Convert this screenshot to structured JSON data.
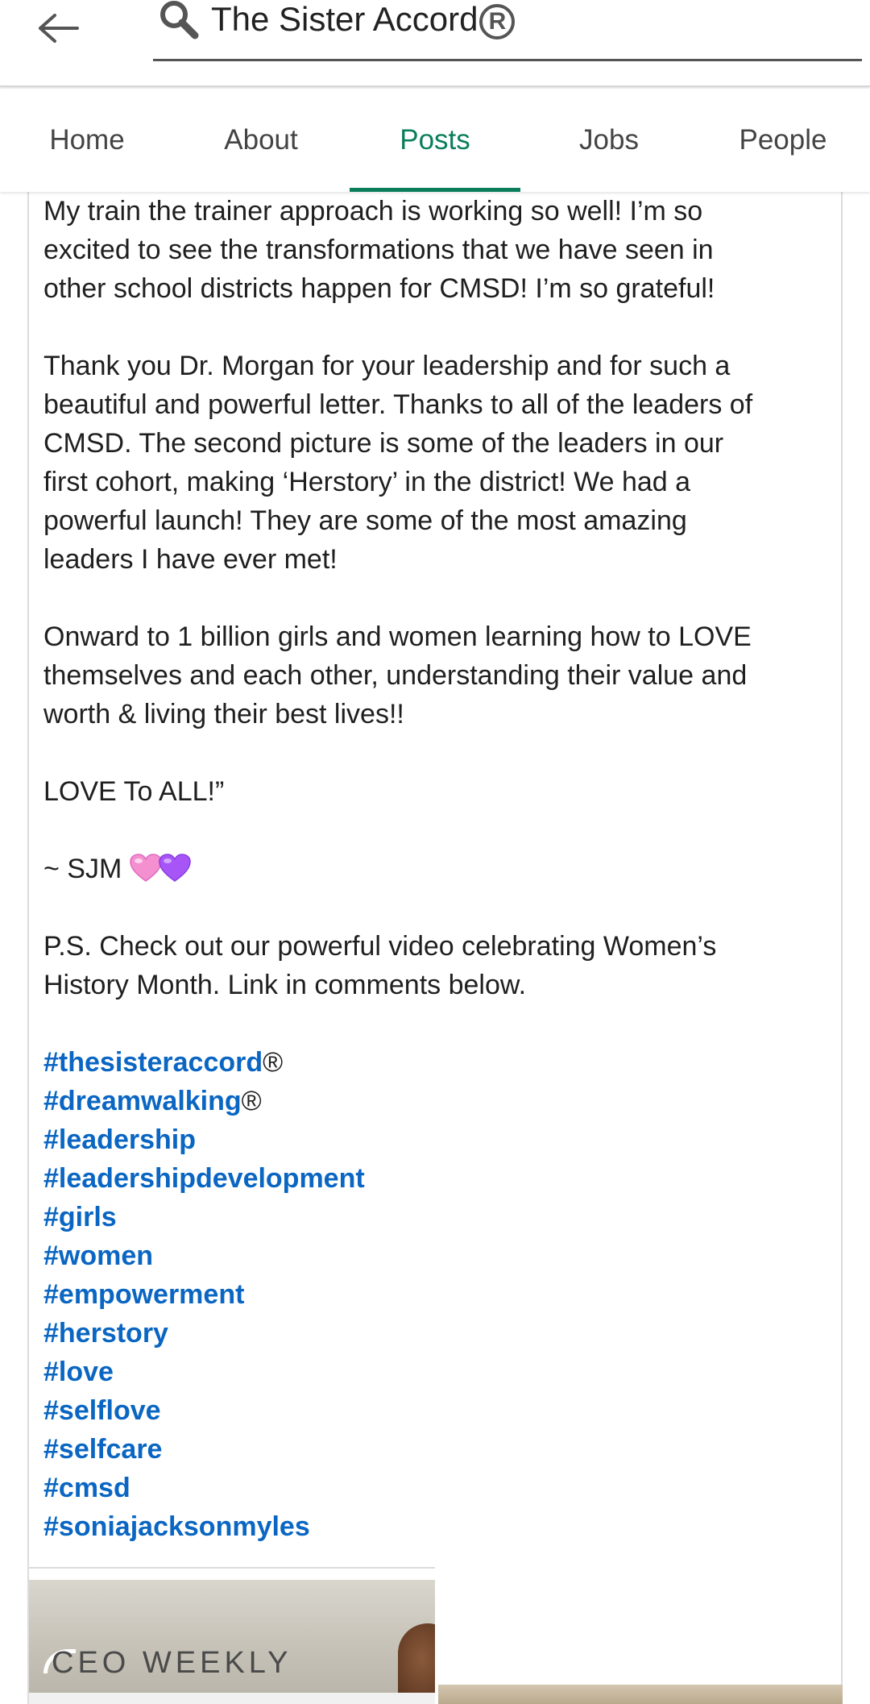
{
  "header": {
    "search_value": "The Sister Accord",
    "search_reg_mark": "R"
  },
  "tabs": [
    {
      "label": "Home",
      "active": false
    },
    {
      "label": "About",
      "active": false
    },
    {
      "label": "Posts",
      "active": true
    },
    {
      "label": "Jobs",
      "active": false
    },
    {
      "label": "People",
      "active": false
    }
  ],
  "post": {
    "para1": [
      "My train the trainer approach is working so well!  I’m so",
      "excited to see the transformations that we have seen in",
      "other school districts happen for CMSD!  I’m so grateful!"
    ],
    "para2": [
      "Thank you Dr. Morgan for your leadership and for such a",
      "beautiful and powerful letter. Thanks to all of the leaders of",
      "CMSD.  The second picture is some of the leaders in our",
      "first cohort, making ‘Herstory’ in the district!  We had a",
      "powerful launch!  They are some of the most amazing",
      "leaders I have ever met!"
    ],
    "para3": [
      "Onward to 1 billion girls and women learning how to LOVE",
      "themselves and each other, understanding their value and",
      "worth & living their best lives!!"
    ],
    "para4": "LOVE To ALL!”",
    "signature": "~ SJM",
    "ps": [
      "P.S. Check out our powerful video celebrating Women’s",
      "History Month.  Link in comments below."
    ],
    "hashtags": [
      {
        "tag": "#thesisteraccord",
        "suffix": "®"
      },
      {
        "tag": "#dreamwalking",
        "suffix": "®"
      },
      {
        "tag": "#leadership",
        "suffix": ""
      },
      {
        "tag": "#leadershipdevelopment",
        "suffix": ""
      },
      {
        "tag": "#girls",
        "suffix": ""
      },
      {
        "tag": "#women",
        "suffix": ""
      },
      {
        "tag": "#empowerment",
        "suffix": ""
      },
      {
        "tag": "#herstory",
        "suffix": ""
      },
      {
        "tag": "#love",
        "suffix": ""
      },
      {
        "tag": "#selflove",
        "suffix": ""
      },
      {
        "tag": "#selfcare",
        "suffix": ""
      },
      {
        "tag": "#cmsd",
        "suffix": ""
      },
      {
        "tag": "#soniajacksonmyles",
        "suffix": ""
      }
    ]
  },
  "preview": {
    "logo_text": "CEO WEEKLY"
  },
  "colors": {
    "accent": "#0a7e5a",
    "link": "#0a66c2",
    "heart_pink": "#f48fd0",
    "heart_purple": "#a855f7"
  },
  "icons": {
    "back": "arrow-left-icon",
    "search": "search-icon",
    "heart_1": "pink-heart-icon",
    "heart_2": "purple-heart-icon"
  }
}
